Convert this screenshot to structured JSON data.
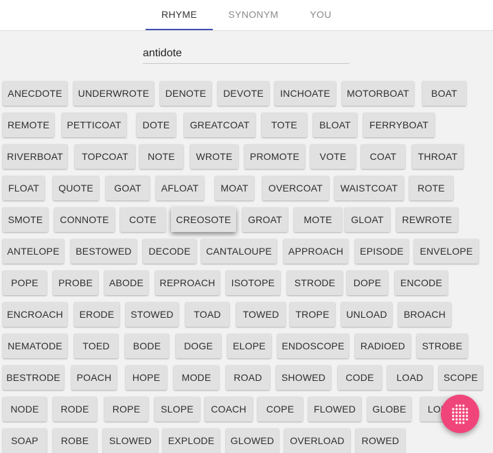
{
  "tabs": [
    {
      "label": "RHYME",
      "active": true
    },
    {
      "label": "SYNONYM",
      "active": false
    },
    {
      "label": "YOU",
      "active": false
    }
  ],
  "search": {
    "value": "antidote"
  },
  "colors": {
    "accent": "#3f51b5",
    "chip_bg": "#e1e1e1",
    "fab": "#f0457a",
    "background": "#f2f2f2"
  },
  "fab": {
    "icon": "dots-grid-icon"
  },
  "word_rows": [
    [
      "ANECDOTE",
      "UNDERWROTE",
      "DENOTE",
      "DEVOTE",
      "INCHOATE",
      "MOTORBOAT",
      "BOAT"
    ],
    [
      "REMOTE",
      "PETTICOAT",
      "DOTE",
      "GREATCOAT",
      "TOTE",
      "BLOAT",
      "FERRYBOAT"
    ],
    [
      "RIVERBOAT",
      "TOPCOAT",
      "NOTE",
      "WROTE",
      "PROMOTE",
      "VOTE",
      "COAT",
      "THROAT"
    ],
    [
      "FLOAT",
      "QUOTE",
      "GOAT",
      "AFLOAT",
      "MOAT",
      "OVERCOAT",
      "WAISTCOAT",
      "ROTE"
    ],
    [
      "SMOTE",
      "CONNOTE",
      "COTE",
      "CREOSOTE",
      "GROAT",
      "MOTE",
      "GLOAT",
      "REWROTE"
    ],
    [
      "ANTELOPE",
      "BESTOWED",
      "DECODE",
      "CANTALOUPE",
      "APPROACH",
      "EPISODE",
      "ENVELOPE"
    ],
    [
      "POPE",
      "PROBE",
      "ABODE",
      "REPROACH",
      "ISOTOPE",
      "STRODE",
      "DOPE",
      "ENCODE"
    ],
    [
      "ENCROACH",
      "ERODE",
      "STOWED",
      "TOAD",
      "TOWED",
      "TROPE",
      "UNLOAD",
      "BROACH"
    ],
    [
      "NEMATODE",
      "TOED",
      "BODE",
      "DOGE",
      "ELOPE",
      "ENDOSCOPE",
      "RADIOED",
      "STROBE"
    ],
    [
      "BESTRODE",
      "POACH",
      "HOPE",
      "MODE",
      "ROAD",
      "SHOWED",
      "CODE",
      "LOAD",
      "SCOPE"
    ],
    [
      "NODE",
      "RODE",
      "ROPE",
      "SLOPE",
      "COACH",
      "COPE",
      "FLOWED",
      "GLOBE",
      "LOBE"
    ],
    [
      "SOAP",
      "ROBE",
      "SLOWED",
      "EXPLODE",
      "GLOWED",
      "OVERLOAD",
      "ROWED"
    ]
  ]
}
